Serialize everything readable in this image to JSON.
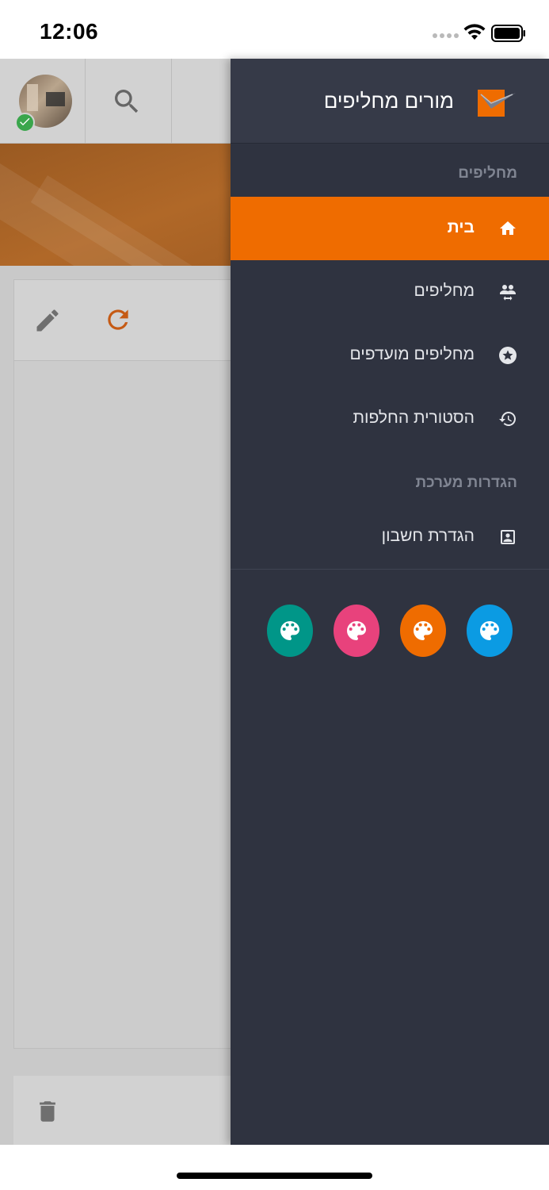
{
  "status_bar": {
    "time": "12:06",
    "icons": [
      "signal-dots",
      "wifi-icon",
      "battery-icon"
    ]
  },
  "background_app": {
    "toolbar_icons": [
      "avatar",
      "verified-check-icon",
      "search-icon"
    ],
    "card_toolbar_icons": [
      "pencil-icon",
      "refresh-icon"
    ],
    "bottom_icons": [
      "trash-icon"
    ]
  },
  "drawer": {
    "title": "מורים מחליפים",
    "logo_icon": "app-logo-icon",
    "sections": [
      {
        "header": "מחליפים",
        "items": [
          {
            "label": "בית",
            "icon": "home-icon",
            "active": true
          },
          {
            "label": "מחליפים",
            "icon": "swap-people-icon",
            "active": false
          },
          {
            "label": "מחליפים מועדפים",
            "icon": "star-circle-icon",
            "active": false
          },
          {
            "label": "הסטורית החלפות",
            "icon": "history-icon",
            "active": false
          }
        ]
      },
      {
        "header": "הגדרות מערכת",
        "items": [
          {
            "label": "הגדרת חשבון",
            "icon": "account-box-icon",
            "active": false
          }
        ]
      }
    ],
    "theme_colors": [
      {
        "name": "blue",
        "color": "#0b9be3"
      },
      {
        "name": "orange",
        "color": "#ef6c00"
      },
      {
        "name": "pink",
        "color": "#e8427c"
      },
      {
        "name": "teal",
        "color": "#009688"
      }
    ]
  },
  "colors": {
    "accent": "#ef6c00",
    "drawer_bg": "#2f3340",
    "refresh_icon": "#c55a14"
  }
}
